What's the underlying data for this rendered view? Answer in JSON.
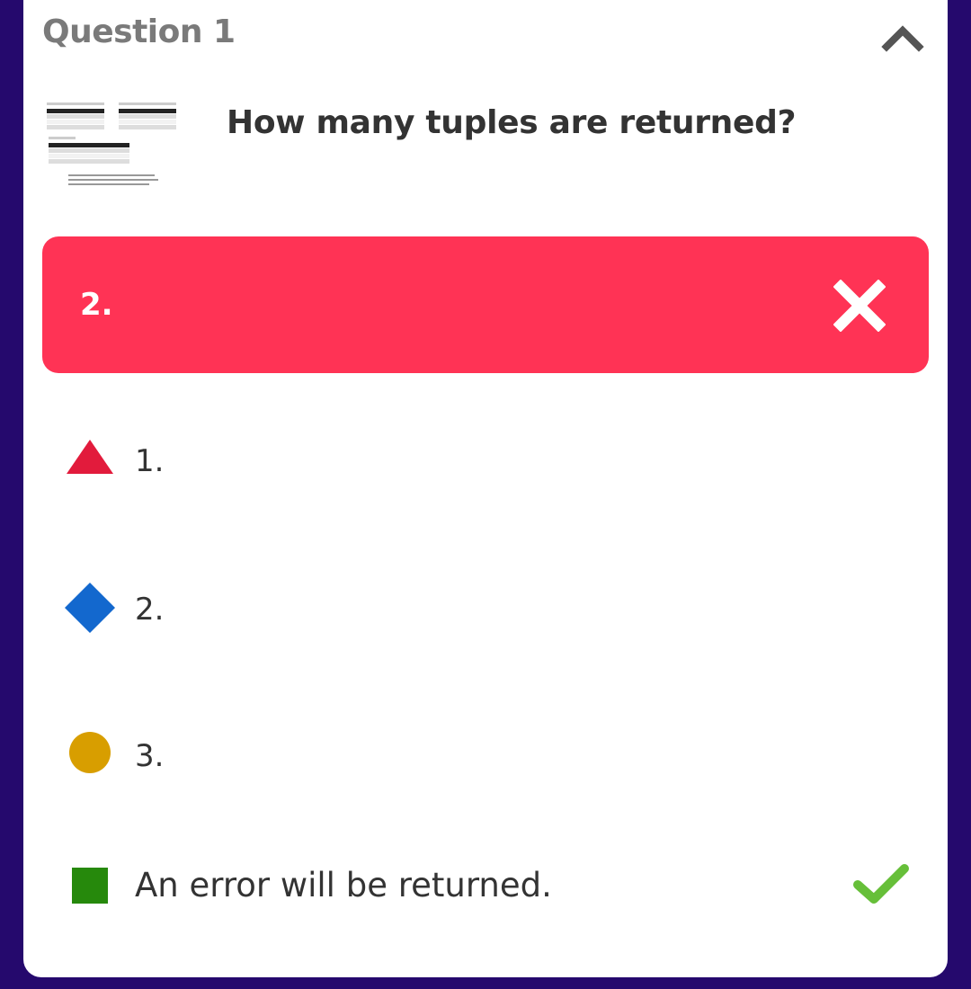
{
  "question": {
    "title": "Question 1",
    "text": "How many tuples are returned?",
    "collapse_icon": "chevron-up-icon",
    "thumbnail_icon": "tables-thumbnail"
  },
  "selected_answer": {
    "label": "2.",
    "status": "incorrect",
    "color": "#ff3355",
    "icon": "close-icon"
  },
  "options": [
    {
      "shape": "triangle",
      "color": "#e21b3c",
      "label": "1."
    },
    {
      "shape": "diamond",
      "color": "#1368ce",
      "label": "2."
    },
    {
      "shape": "circle",
      "color": "#d89e00",
      "label": "3."
    },
    {
      "shape": "square",
      "color": "#26890c",
      "label": "An error will be returned.",
      "correct": true,
      "correct_icon": "checkmark-icon"
    }
  ],
  "colors": {
    "background": "#25096d",
    "card": "#ffffff",
    "correct": "#66bf39"
  }
}
